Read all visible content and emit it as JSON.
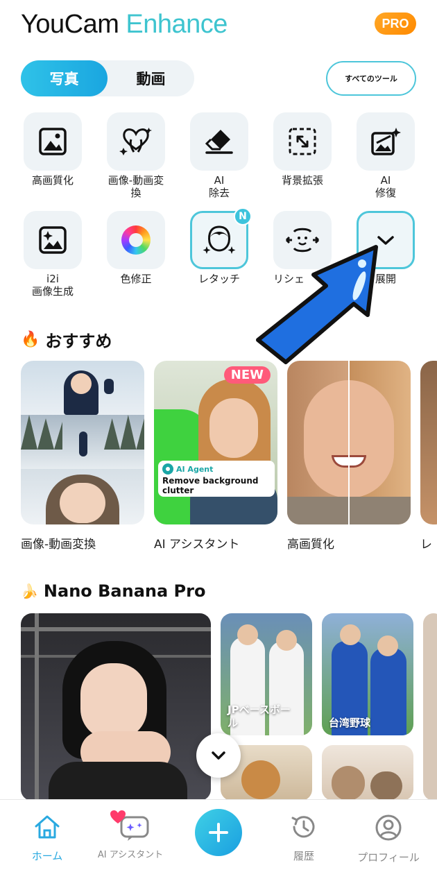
{
  "app": {
    "title_part1": "YouCam",
    "title_part2": "Enhance",
    "pro_badge": "PRO"
  },
  "media_toggle": {
    "photo": "写真",
    "video": "動画"
  },
  "all_tools_label": "すべてのツール",
  "tools_row1": [
    {
      "label": "高画質化",
      "icon": "image-icon"
    },
    {
      "label": "画像-動画変換",
      "icon": "heart-hands-icon"
    },
    {
      "label": "AI\n除去",
      "icon": "eraser-icon"
    },
    {
      "label": "背景拡張",
      "icon": "expand-icon"
    },
    {
      "label": "AI\n修復",
      "icon": "restore-sparkle-icon"
    }
  ],
  "tools_row2": [
    {
      "label": "i2i\n画像生成",
      "icon": "image-sparkle-icon"
    },
    {
      "label": "色修正",
      "icon": "color-wheel-icon"
    },
    {
      "label": "レタッチ",
      "icon": "face-sparkle-icon",
      "badge": "N"
    },
    {
      "label": "リシェ",
      "icon": "reshape-face-icon"
    },
    {
      "label": "展開",
      "icon": "chevron-down-icon"
    }
  ],
  "recommended": {
    "title": "おすすめ",
    "cards": [
      {
        "label": "画像-動画変換"
      },
      {
        "label": "AI アシスタント",
        "badge": "NEW",
        "agent_tag": "AI Agent",
        "agent_text": "Remove background clutter"
      },
      {
        "label": "高画質化"
      },
      {
        "label": "レ"
      }
    ]
  },
  "nano_banana": {
    "title": "Nano Banana Pro",
    "cards": [
      {
        "caption": "JPベースボー\nル"
      },
      {
        "caption": "台湾野球"
      }
    ]
  },
  "bottom_nav": {
    "home": "ホーム",
    "assistant": "AI アシスタント",
    "history": "履歴",
    "profile": "プロフィール"
  },
  "colors": {
    "accent": "#29a9e0",
    "teal": "#4dc6da",
    "pro": "#ff8a00",
    "new_badge": "#ff5a7a",
    "arrow": "#1f6fe0"
  }
}
